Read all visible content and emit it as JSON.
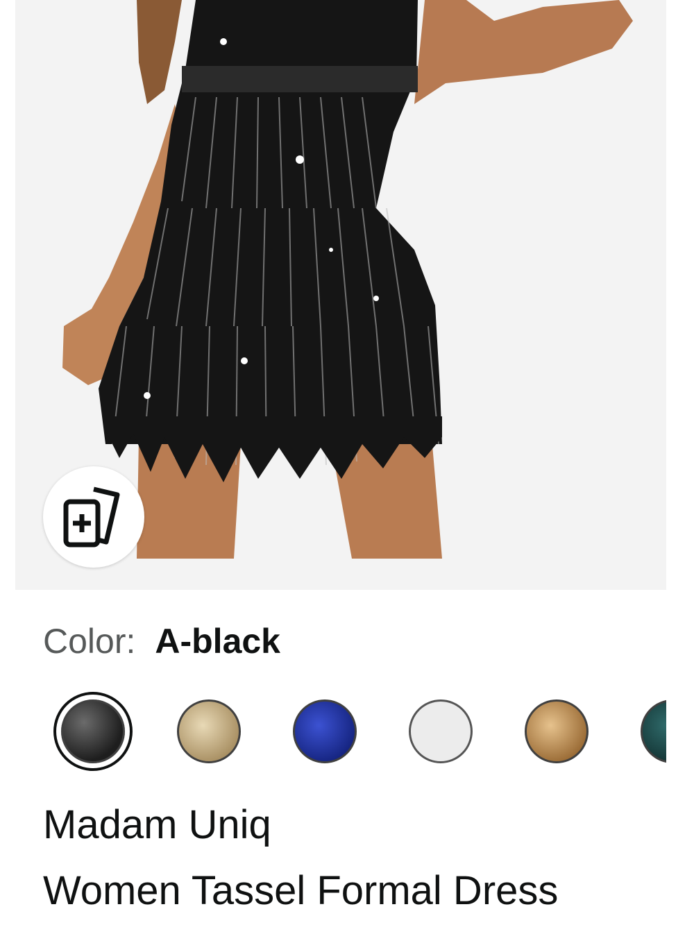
{
  "product": {
    "image_alt": "Black sequin tassel fringe dress",
    "brand": "Madam Uniq",
    "title": "Women Tassel Formal Dress"
  },
  "color_selector": {
    "label": "Color:",
    "selected_value": "A-black",
    "swatches": [
      {
        "name": "black",
        "color": "#2b2b2b",
        "selected": true
      },
      {
        "name": "champagne",
        "color": "#c9b48c",
        "selected": false
      },
      {
        "name": "royal-blue",
        "color": "#1f33a8",
        "selected": false
      },
      {
        "name": "white",
        "color": "#ececec",
        "selected": false
      },
      {
        "name": "gold",
        "color": "#c59a5f",
        "selected": false
      },
      {
        "name": "teal",
        "color": "#1f4a4a",
        "selected": false
      }
    ]
  },
  "icons": {
    "add_to_collection": "add-to-collection-icon"
  }
}
